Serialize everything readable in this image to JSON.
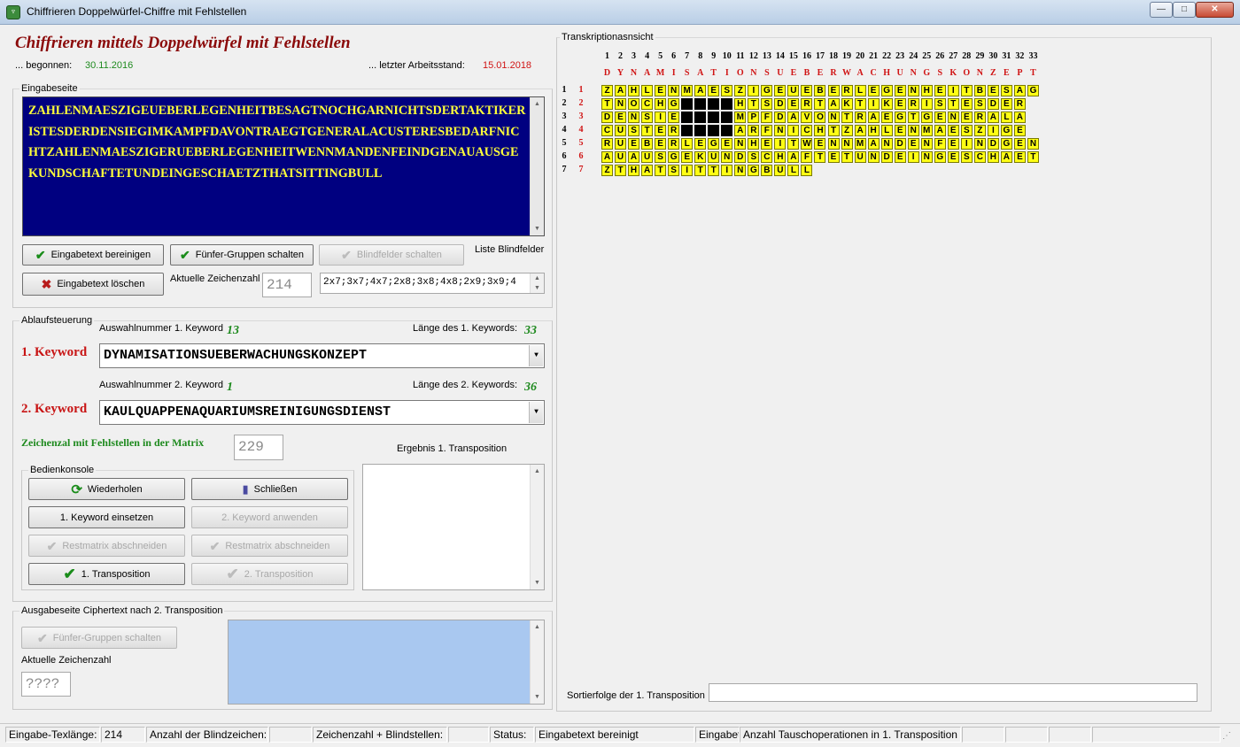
{
  "window": {
    "title": "Chiffrieren Doppelwürfel-Chiffre mit Fehlstellen",
    "min": "—",
    "max": "□",
    "close": "✕"
  },
  "header": {
    "title": "Chiffrieren mittels Doppelwürfel mit Fehlstellen",
    "begun_label": "... begonnen:",
    "begun_date": "30.11.2016",
    "last_label": "... letzter Arbeitsstand:",
    "last_date": "15.01.2018"
  },
  "input": {
    "group_label": "Eingabeseite",
    "text": "ZAHLENMAESZIGEUEBERLEGENHEITBESAGTNOCHGARNICHTSDERTAKTIKERISTESDERDENSIEGIMKAMPFDAVONTRAEGTGENERALACUSTERESBEDARFNICHTZAHLENMAESZIGERUEBERLEGENHEITWENNMANDENFEINDGENAUAUSGEKUNDSCHAFTETUNDEINGESCHAETZTHATSITTINGBULL",
    "btn_clean": "Eingabetext bereinigen",
    "btn_groups": "Fünfer-Gruppen schalten",
    "btn_blind": "Blindfelder schalten",
    "blind_list_label": "Liste Blindfelder",
    "btn_delete": "Eingabetext löschen",
    "count_label": "Aktuelle Zeichenzahl",
    "count_value": "214",
    "blind_list": "2x7;3x7;4x7;2x8;3x8;4x8;2x9;3x9;4"
  },
  "control": {
    "group_label": "Ablaufsteuerung",
    "sel1_label": "Auswahlnummer 1. Keyword",
    "sel1_value": "13",
    "len1_label": "Länge des 1. Keywords:",
    "len1_value": "33",
    "kw1_label": "1. Keyword",
    "kw1_value": "DYNAMISATIONSUEBERWACHUNGSKONZEPT",
    "sel2_label": "Auswahlnummer 2. Keyword",
    "sel2_value": "1",
    "len2_label": "Länge des 2. Keywords:",
    "len2_value": "36",
    "kw2_label": "2. Keyword",
    "kw2_value": "KAULQUAPPENAQUARIUMSREINIGUNGSDIENST",
    "gap_label": "Zeichenzal mit Fehlstellen in der Matrix",
    "gap_value": "229",
    "result_label": "Ergebnis 1. Transposition"
  },
  "console": {
    "group_label": "Bedienkonsole",
    "btn_repeat": "Wiederholen",
    "btn_close": "Schließen",
    "btn_kw1": "1. Keyword einsetzen",
    "btn_kw2": "2. Keyword anwenden",
    "btn_cut1": "Restmatrix abschneiden",
    "btn_cut2": "Restmatrix abschneiden",
    "btn_t1": "1. Transposition",
    "btn_t2": "2. Transposition"
  },
  "output": {
    "group_label": "Ausgabeseite Ciphertext nach 2. Transposition",
    "btn_groups": "Fünfer-Gruppen schalten",
    "count_label": "Aktuelle Zeichenzahl",
    "count_value": "????"
  },
  "transcript": {
    "group_label": "Transkriptionasnsicht",
    "keyword": "DYNAMISATIONSUEBERWACHUNGSKONZEPT",
    "rows": [
      "ZAHLENMAESZIGEUEBERLEGENHEITBESAG",
      "TNOCHG###HTSDERTAKTIKERISTESDER",
      "DENSIE###MPFDAVONTRAEGTGENERALA",
      "CUSTER###ARFNICHTZAHLENMAESZIGE",
      "RUEBERLEGENHEITWENNMANDENFEINDGEN",
      "AUAUSGEKUNDSCHAFTETUNDEINGESCHAET",
      "ZTHATSITTINGBULL"
    ],
    "blind_cols": [
      7,
      8,
      9,
      10
    ],
    "blind_rows": [
      2,
      3,
      4
    ],
    "sort_label": "Sortierfolge der 1. Transposition",
    "sort_value": ""
  },
  "status": {
    "len_label": "Eingabe-Texlänge:",
    "len_value": "214",
    "blind_label": "Anzahl der Blindzeichen:",
    "blind_value": "",
    "sum_label": "Zeichenzahl + Blindstellen:",
    "sum_value": "",
    "status_label": "Status:",
    "status_value": "Eingabetext bereinigt",
    "extra1": "Eingabet",
    "extra2": "Anzahl Tauschoperationen in 1. Transposition"
  },
  "colors": {
    "accent_red": "#c81414",
    "accent_green": "#1e8a1e",
    "input_bg": "#000080",
    "input_text": "#ffff3a",
    "cell_yellow": "#ffff14",
    "output_bg": "#a9c8f0"
  }
}
